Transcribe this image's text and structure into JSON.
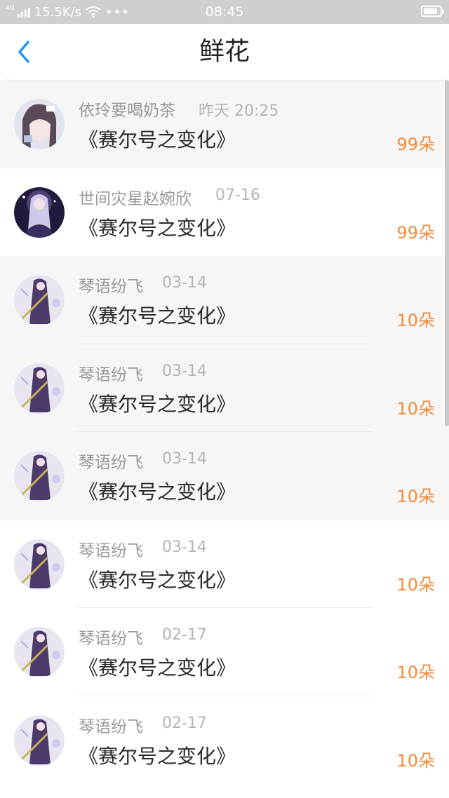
{
  "status_bar": {
    "network_type": "4G",
    "speed": "15.5K/s",
    "more": "•••",
    "time": "08:45",
    "battery_level": 0.85
  },
  "header": {
    "back_icon": "chevron-left-icon",
    "title": "鲜花"
  },
  "colors": {
    "accent_back": "#2196F3",
    "count_orange": "#F08A3C",
    "name_gray": "#999999",
    "date_gray": "#B4B4B4",
    "title_dark": "#2A2A2A"
  },
  "items": [
    {
      "name": "依玲要喝奶茶",
      "date": "昨天 20:25",
      "title": "《赛尔号之变化》",
      "count": "99朵"
    },
    {
      "name": "世间灾星赵婉欣",
      "date": "07-16",
      "title": "《赛尔号之变化》",
      "count": "99朵"
    },
    {
      "name": "琴语纷飞",
      "date": "03-14",
      "title": "《赛尔号之变化》",
      "count": "10朵"
    },
    {
      "name": "琴语纷飞",
      "date": "03-14",
      "title": "《赛尔号之变化》",
      "count": "10朵"
    },
    {
      "name": "琴语纷飞",
      "date": "03-14",
      "title": "《赛尔号之变化》",
      "count": "10朵"
    },
    {
      "name": "琴语纷飞",
      "date": "03-14",
      "title": "《赛尔号之变化》",
      "count": "10朵"
    },
    {
      "name": "琴语纷飞",
      "date": "02-17",
      "title": "《赛尔号之变化》",
      "count": "10朵"
    },
    {
      "name": "琴语纷飞",
      "date": "02-17",
      "title": "《赛尔号之变化》",
      "count": "10朵"
    }
  ]
}
